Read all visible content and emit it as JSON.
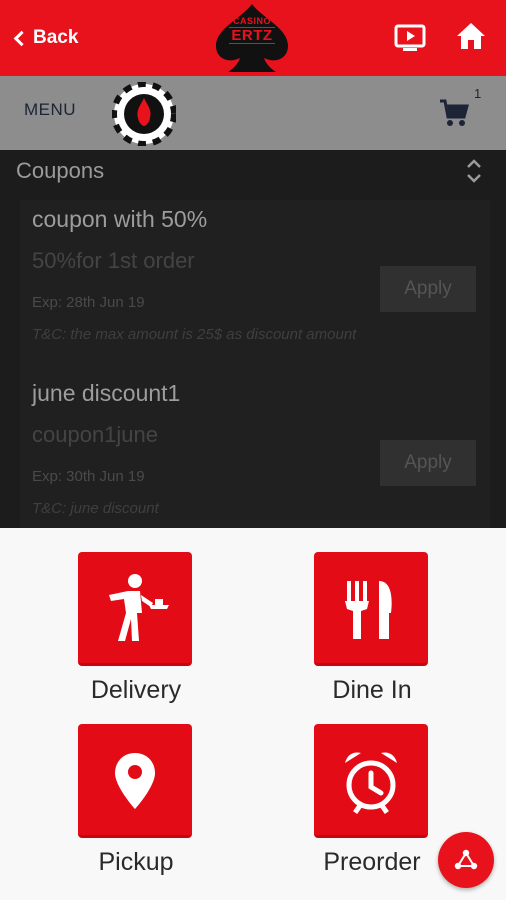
{
  "header": {
    "back_label": "Back",
    "logo_top": "CASINO",
    "logo_main": "ERTZ",
    "icons": [
      "chevron-left-icon",
      "tv-icon",
      "home-icon"
    ],
    "accent_color": "#e8121d"
  },
  "menubar": {
    "menu_label": "MENU",
    "cart_count": "1"
  },
  "coupons": {
    "title": "Coupons",
    "items": [
      {
        "name": "coupon with 50%",
        "code": "50%for 1st order",
        "expiry": "Exp: 28th Jun 19",
        "terms": "T&C: the max amount is 25$ as discount amount",
        "apply_label": "Apply"
      },
      {
        "name": "june discount1",
        "code": "coupon1june",
        "expiry": "Exp: 30th Jun 19",
        "terms": "T&C: june discount",
        "apply_label": "Apply"
      }
    ]
  },
  "order_types": [
    {
      "label": "Delivery",
      "icon": "waiter-icon"
    },
    {
      "label": "Dine In",
      "icon": "fork-knife-icon"
    },
    {
      "label": "Pickup",
      "icon": "location-pin-icon"
    },
    {
      "label": "Preorder",
      "icon": "alarm-clock-icon"
    }
  ],
  "fab": {
    "icon": "share-icon"
  }
}
